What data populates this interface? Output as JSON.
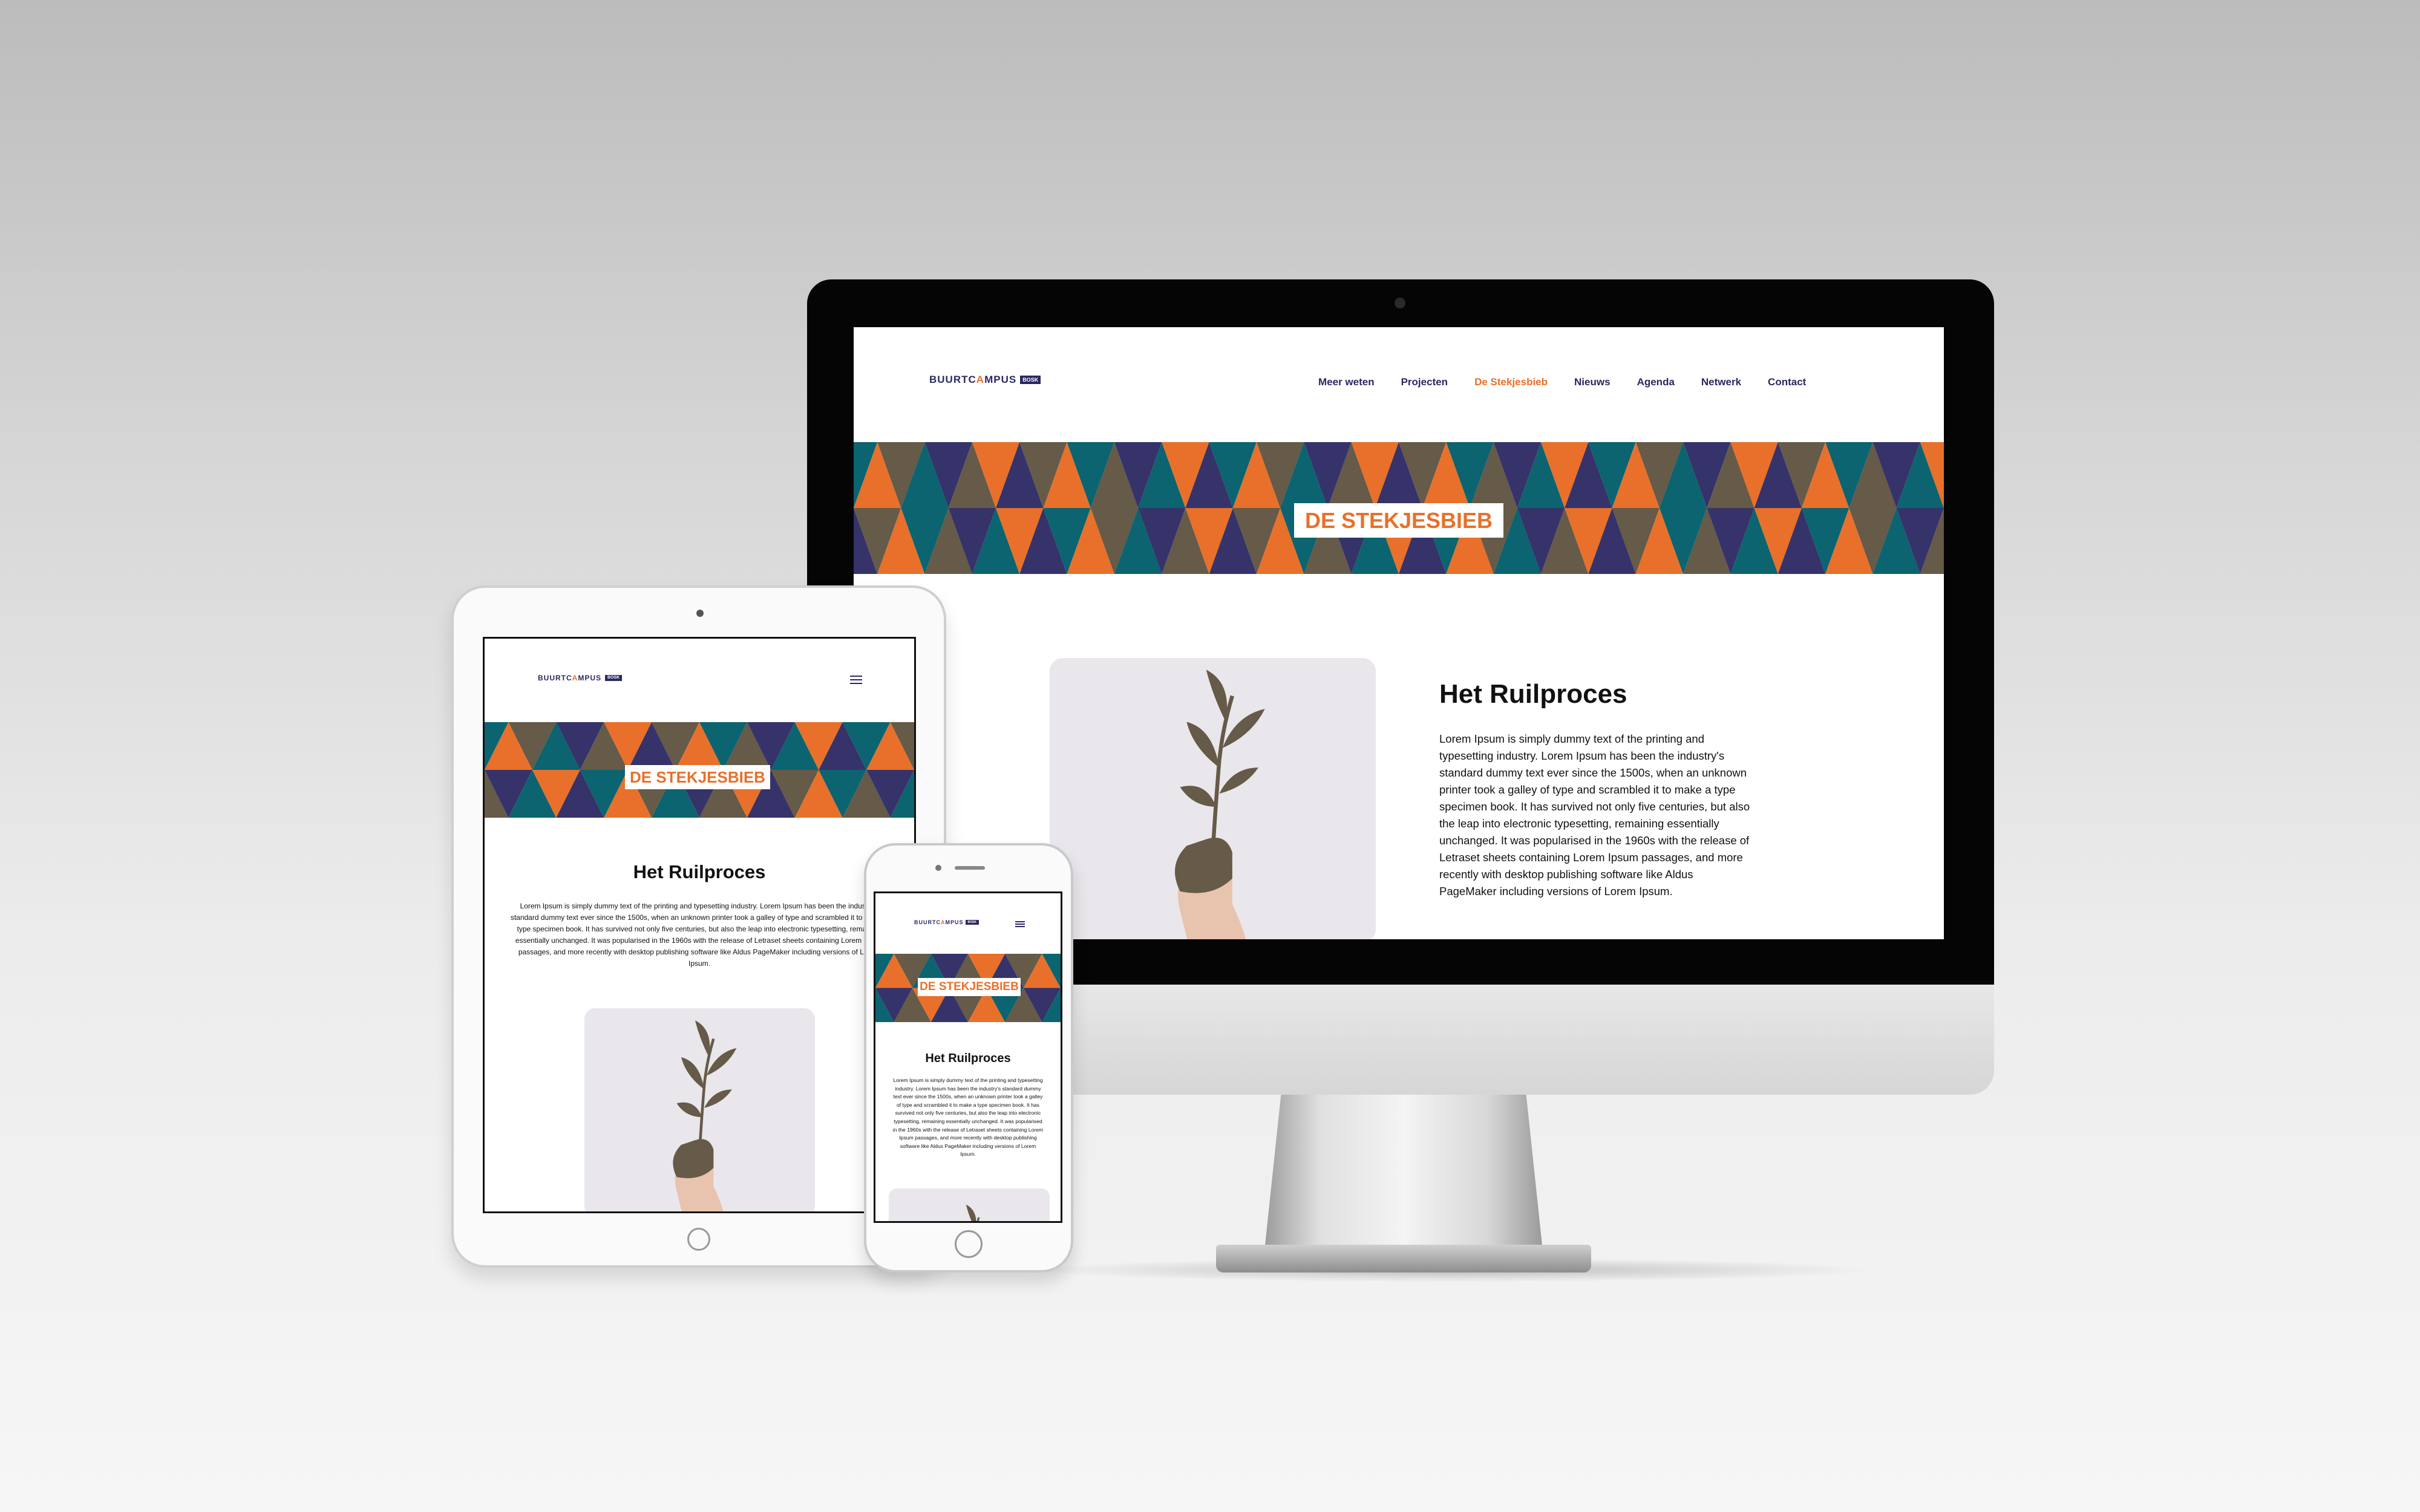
{
  "site": {
    "logo": {
      "text_1": "BUURTC",
      "text_accent": "A",
      "text_2": "MPUS",
      "badge": "BOSK"
    },
    "nav": [
      "Meer weten",
      "Projecten",
      "De Stekjesbieb",
      "Nieuws",
      "Agenda",
      "Netwerk",
      "Contact"
    ],
    "active_nav": "De Stekjesbieb",
    "banner_title": "DE STEKJESBIEB",
    "heading": "Het Ruilproces",
    "body_desktop": "Lorem Ipsum is simply dummy text of the printing and typesetting industry. Lorem Ipsum has been the industry's standard dummy text ever since the 1500s, when an unknown printer took a galley of type and scrambled it to make a type specimen book. It has survived not only five centuries, but also the leap into electronic typesetting, remaining essentially unchanged. It was popularised in the 1960s with the release of Letraset sheets containing Lorem Ipsum passages, and more recently with desktop publishing software like Aldus PageMaker including versions of Lorem Ipsum.",
    "body_tablet": "Lorem Ipsum is simply dummy text of the printing and typesetting industry. Lorem Ipsum has been the industry's standard dummy text ever since the 1500s, when an unknown printer took a galley of type and scrambled it to make a type specimen book. It has survived not only five centuries, but also the leap into electronic typesetting, remaining essentially unchanged. It was popularised in the 1960s with the release of Letraset sheets containing Lorem Ipsum passages, and more recently with desktop publishing software like Aldus PageMaker including versions of Lorem Ipsum.",
    "body_phone": "Lorem Ipsum is simply dummy text of the printing and typesetting industry. Lorem Ipsum has been the industry's standard dummy text ever since the 1500s, when an unknown printer took a galley of type and scrambled it to make a type specimen book. It has survived not only five centuries, but also the leap into electronic typesetting, remaining essentially unchanged. It was popularised in the 1960s with the release of Letraset sheets containing Lorem Ipsum passages, and more recently with desktop publishing software like Aldus PageMaker including versions of Lorem Ipsum.",
    "menu_icon": "hamburger-menu-icon",
    "image_icon": "hand-holding-plant-image"
  },
  "colors": {
    "navy": "#2a2860",
    "orange": "#e8702a",
    "teal": "#0b6470",
    "olive": "#665a48",
    "indigo": "#35336a",
    "card_bg": "#e9e7ec"
  },
  "devices": [
    "imac",
    "ipad",
    "iphone"
  ]
}
